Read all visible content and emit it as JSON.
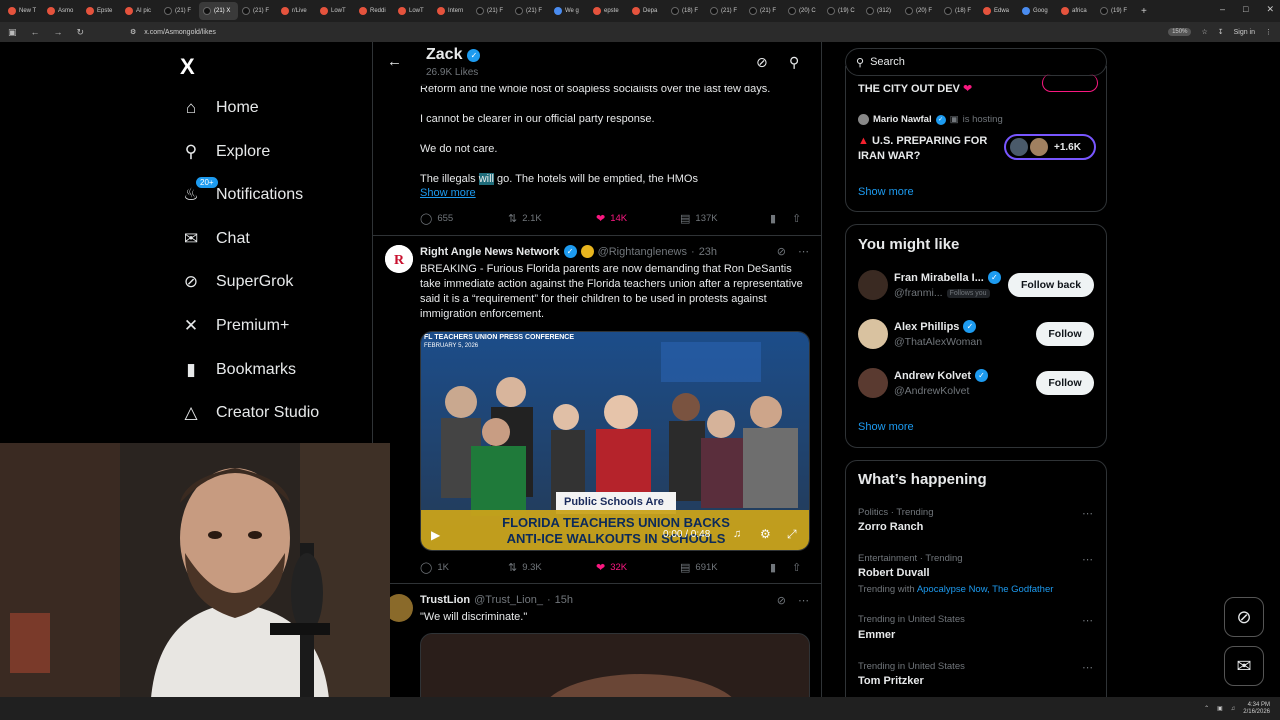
{
  "browser": {
    "tabs": [
      "New T",
      "Asmo",
      "Epste",
      "AI pic",
      "(21) F",
      "(21) X",
      "(21) F",
      "r/Live",
      "LowT",
      "Reddi",
      "LowT",
      "Intern",
      "(21) F",
      "(21) F",
      "We g",
      "epste",
      "Depa",
      "(18) F",
      "(21) F",
      "(21) F",
      "(20) C",
      "(19) C",
      "(312)",
      "(20) F",
      "(18) F",
      "Edwa",
      "Goog",
      "africa",
      "(19) F"
    ],
    "active_tab_index": 5,
    "url": "x.com/Asmongold/likes",
    "zoom": "150%",
    "sign_in": "Sign in"
  },
  "sidebar": {
    "logo": "X",
    "items": [
      {
        "label": "Home",
        "icon": "home-icon"
      },
      {
        "label": "Explore",
        "icon": "search-icon"
      },
      {
        "label": "Notifications",
        "icon": "bell-icon",
        "badge": "20+"
      },
      {
        "label": "Chat",
        "icon": "mail-icon"
      },
      {
        "label": "SuperGrok",
        "icon": "grok-icon"
      },
      {
        "label": "Premium+",
        "icon": "x-icon"
      },
      {
        "label": "Bookmarks",
        "icon": "bookmark-icon"
      },
      {
        "label": "Creator Studio",
        "icon": "creator-icon"
      }
    ]
  },
  "feed": {
    "header": {
      "name": "Zack",
      "sub": "26.9K Likes"
    },
    "post1": {
      "lines": [
        "Reform and the whole host of soapless socialists over the last few days.",
        "I cannot be clearer in our official party response.",
        "We do not care."
      ],
      "last_line_pre": "The illegals ",
      "last_line_hl": "will",
      "last_line_post": " go. The hotels will be emptied, the HMOs",
      "show_more": "Show more",
      "replies": "655",
      "reposts": "2.1K",
      "likes": "14K",
      "views": "137K"
    },
    "post2": {
      "name": "Right Angle News Network",
      "handle": "@Rightanglenews",
      "time": "23h",
      "text": "BREAKING - Furious Florida parents are now demanding that Ron DeSantis take immediate action against the Florida teachers union after a representative said it is a “requirement” for their children to be used in protests against immigration enforcement.",
      "video_tag": "FL TEACHERS UNION PRESS CONFERENCE",
      "video_date": "FEBRUARY 5, 2026",
      "banner_sign": "Public Schools Are",
      "caption_line1": "FLORIDA TEACHERS UNION BACKS",
      "caption_line2": "ANTI-ICE WALKOUTS IN SCHOOLS",
      "video_time": "0:00 / 0:48",
      "replies": "1K",
      "reposts": "9.3K",
      "likes": "32K",
      "views": "691K"
    },
    "post3": {
      "name": "TrustLion",
      "handle": "@Trust_Lion_",
      "time": "15h",
      "text": "\"We will discriminate.\""
    }
  },
  "rail": {
    "search_placeholder": "Search",
    "live": {
      "item1_title": "THE CITY OUT DEV",
      "host_name": "Mario Nawfal",
      "host_status": "is hosting",
      "item2_title_line1": "U.S. PREPARING FOR",
      "item2_title_line2": "IRAN WAR?",
      "listeners": "+1.6K",
      "show_more": "Show more"
    },
    "who": {
      "title": "You might like",
      "people": [
        {
          "name": "Fran Mirabella I...",
          "handle": "@franmi...",
          "follows_you": "Follows you",
          "button": "Follow back"
        },
        {
          "name": "Alex Phillips",
          "handle": "@ThatAlexWoman",
          "button": "Follow"
        },
        {
          "name": "Andrew Kolvet",
          "handle": "@AndrewKolvet",
          "button": "Follow"
        }
      ],
      "show_more": "Show more"
    },
    "trending": {
      "title": "What’s happening",
      "items": [
        {
          "meta": "Politics · Trending",
          "name": "Zorro Ranch"
        },
        {
          "meta": "Entertainment · Trending",
          "name": "Robert Duvall",
          "extra_pre": "Trending with",
          "extra_links": "Apocalypse Now, The Godfather"
        },
        {
          "meta": "Trending in United States",
          "name": "Emmer"
        },
        {
          "meta": "Trending in United States",
          "name": "Tom Pritzker"
        }
      ]
    }
  },
  "taskbar": {
    "time": "4:34 PM",
    "date": "2/16/2026"
  }
}
